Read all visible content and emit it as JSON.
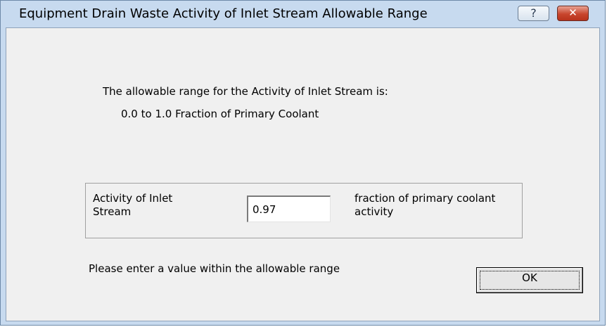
{
  "window": {
    "title": "Equipment Drain Waste Activity of Inlet Stream Allowable Range",
    "help_glyph": "?",
    "close_glyph": "✕"
  },
  "message": {
    "line1": "The allowable range for the Activity of Inlet Stream is:",
    "line2": "0.0 to 1.0 Fraction of Primary Coolant"
  },
  "field": {
    "label": "Activity of Inlet Stream",
    "value": "0.97",
    "unit": "fraction of primary coolant activity"
  },
  "prompt": "Please enter a value within the allowable range",
  "ok_label": "OK",
  "colors": {
    "title_bar": "#c7daef",
    "client_bg": "#f0f0f0",
    "close_button": "#c8452d"
  }
}
